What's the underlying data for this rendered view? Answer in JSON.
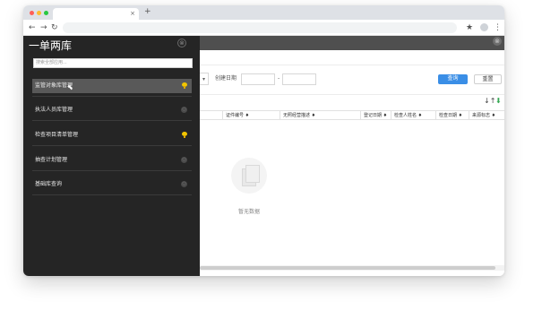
{
  "browser": {
    "tab_close": "×",
    "new_tab": "+",
    "nav": {
      "back": "←",
      "forward": "→",
      "reload": "↻"
    },
    "bookmark_icon": "star-icon",
    "menu_icon": "kebab-menu-icon"
  },
  "app": {
    "close": "⊗"
  },
  "sidebar": {
    "title": "一单两库",
    "close": "⊗",
    "search_placeholder": "搜索全部应用...",
    "items": [
      {
        "label": "监管对象库管理",
        "indicator": "pin",
        "active": true
      },
      {
        "label": "执法人员库管理",
        "indicator": "dot",
        "active": false
      },
      {
        "label": "检查项目清单管理",
        "indicator": "pin",
        "active": false
      },
      {
        "label": "抽查计划管理",
        "indicator": "dot",
        "active": false
      },
      {
        "label": "基础库查询",
        "indicator": "dot",
        "active": false
      }
    ],
    "dot_glyph": "○"
  },
  "filter": {
    "select_arrow": "▾",
    "created_date_label": "创建日期",
    "date_separator": "-",
    "query_button": "查询",
    "reset_button": "重置"
  },
  "table": {
    "columns": [
      "证件编号",
      "无照经营描述",
      "登记日期",
      "检查人姓名",
      "检查日期",
      "来源标志"
    ],
    "sort_glyph": "↓↑",
    "download_glyph": "⬇"
  },
  "empty": {
    "text": "暂无数据"
  },
  "colors": {
    "sidebar_bg": "#252525",
    "active_item_bg": "#595959",
    "primary_button": "#3a8ee6",
    "pin_yellow": "#f2c500",
    "header_bg": "#4f4f4f"
  }
}
